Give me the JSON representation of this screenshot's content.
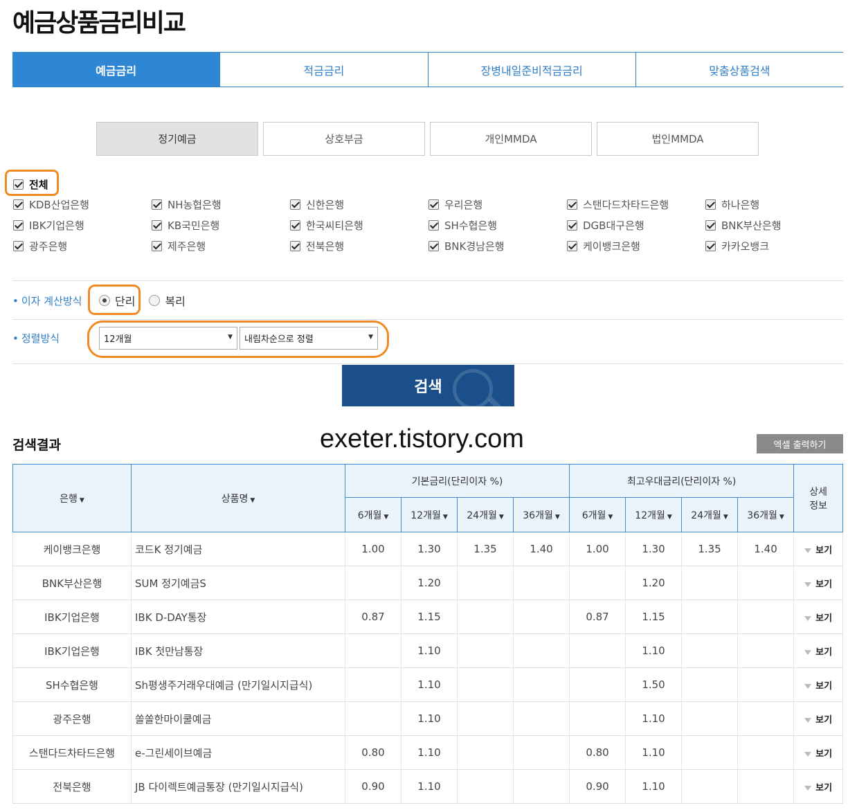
{
  "page_title": "예금상품금리비교",
  "main_tabs": [
    {
      "label": "예금금리",
      "active": true
    },
    {
      "label": "적금금리",
      "active": false
    },
    {
      "label": "장병내일준비적금금리",
      "active": false
    },
    {
      "label": "맞춤상품검색",
      "active": false
    }
  ],
  "sub_tabs": [
    {
      "label": "정기예금",
      "active": true
    },
    {
      "label": "상호부금",
      "active": false
    },
    {
      "label": "개인MMDA",
      "active": false
    },
    {
      "label": "법인MMDA",
      "active": false
    }
  ],
  "filter": {
    "all_label": "전체",
    "banks": [
      "KDB산업은행",
      "NH농협은행",
      "신한은행",
      "우리은행",
      "스탠다드차타드은행",
      "하나은행",
      "IBK기업은행",
      "KB국민은행",
      "한국씨티은행",
      "SH수협은행",
      "DGB대구은행",
      "BNK부산은행",
      "광주은행",
      "제주은행",
      "전북은행",
      "BNK경남은행",
      "케이뱅크은행",
      "카카오뱅크"
    ]
  },
  "interest": {
    "label": "이자 계산방식",
    "options": [
      "단리",
      "복리"
    ],
    "selected": "단리"
  },
  "sort": {
    "label": "정렬방식",
    "period_value": "12개월",
    "order_value": "내림차순으로 정렬"
  },
  "search_button": "검색",
  "results": {
    "title": "검색결과",
    "watermark": "exeter.tistory.com",
    "excel_button": "엑셀 출력하기",
    "headers": {
      "bank": "은행",
      "product": "상품명",
      "base_group": "기본금리(단리이자 %)",
      "max_group": "최고우대금리(단리이자 %)",
      "periods": [
        "6개월",
        "12개월",
        "24개월",
        "36개월"
      ],
      "detail_line1": "상세",
      "detail_line2": "정보"
    },
    "detail_link": "보기",
    "rows": [
      {
        "bank": "케이뱅크은행",
        "product": "코드K 정기예금",
        "base": [
          "1.00",
          "1.30",
          "1.35",
          "1.40"
        ],
        "max": [
          "1.00",
          "1.30",
          "1.35",
          "1.40"
        ]
      },
      {
        "bank": "BNK부산은행",
        "product": "SUM 정기예금S",
        "base": [
          "",
          "1.20",
          "",
          ""
        ],
        "max": [
          "",
          "1.20",
          "",
          ""
        ]
      },
      {
        "bank": "IBK기업은행",
        "product": "IBK D-DAY통장",
        "base": [
          "0.87",
          "1.15",
          "",
          ""
        ],
        "max": [
          "0.87",
          "1.15",
          "",
          ""
        ]
      },
      {
        "bank": "IBK기업은행",
        "product": "IBK 첫만남통장",
        "base": [
          "",
          "1.10",
          "",
          ""
        ],
        "max": [
          "",
          "1.10",
          "",
          ""
        ]
      },
      {
        "bank": "SH수협은행",
        "product": "Sh평생주거래우대예금 (만기일시지급식)",
        "base": [
          "",
          "1.10",
          "",
          ""
        ],
        "max": [
          "",
          "1.50",
          "",
          ""
        ]
      },
      {
        "bank": "광주은행",
        "product": "쏠쏠한마이쿨예금",
        "base": [
          "",
          "1.10",
          "",
          ""
        ],
        "max": [
          "",
          "1.10",
          "",
          ""
        ]
      },
      {
        "bank": "스탠다드차타드은행",
        "product": "e-그린세이브예금",
        "base": [
          "0.80",
          "1.10",
          "",
          ""
        ],
        "max": [
          "0.80",
          "1.10",
          "",
          ""
        ]
      },
      {
        "bank": "전북은행",
        "product": "JB 다이렉트예금통장 (만기일시지급식)",
        "base": [
          "0.90",
          "1.10",
          "",
          ""
        ],
        "max": [
          "0.90",
          "1.10",
          "",
          ""
        ]
      }
    ]
  },
  "colors": {
    "accent_blue": "#2f86d3",
    "search_button_bg": "#1a4f8a",
    "highlight_orange": "#f08a24"
  }
}
